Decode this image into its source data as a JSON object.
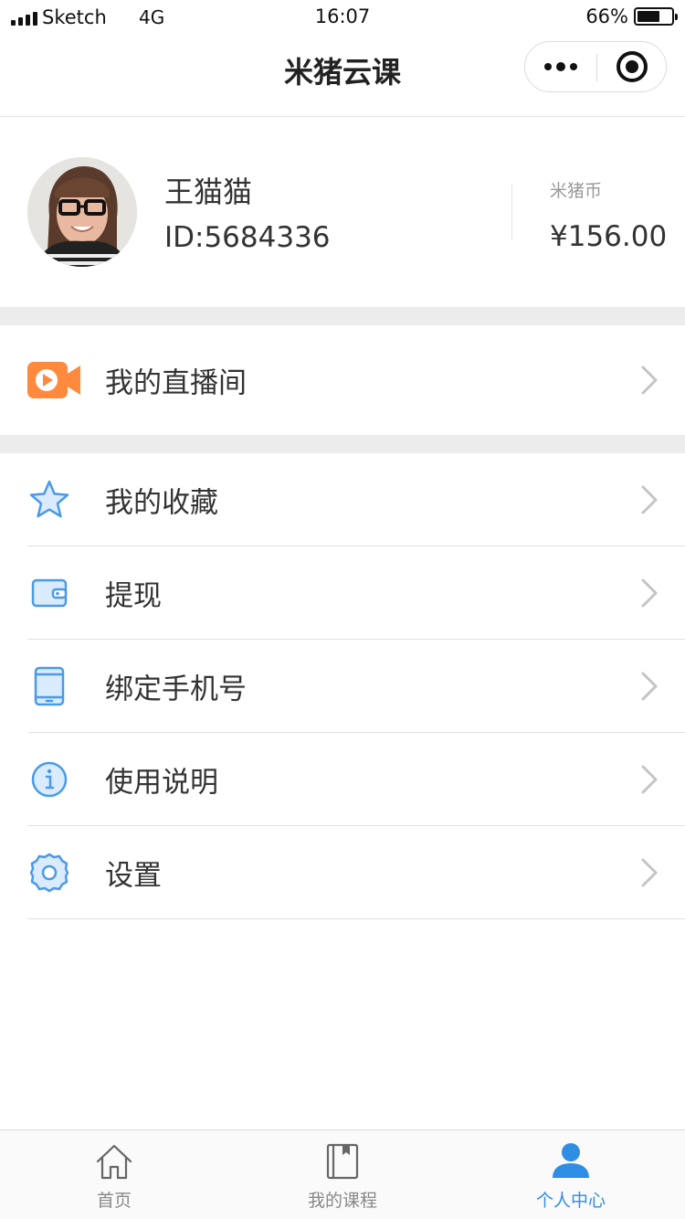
{
  "status_bar": {
    "carrier": "Sketch",
    "network": "4G",
    "time": "16:07",
    "battery_percent": "66%",
    "battery_level": 0.66
  },
  "nav": {
    "title": "米猪云课",
    "more_icon": "more-dots-icon",
    "close_icon": "target-close-icon"
  },
  "profile": {
    "name": "王猫猫",
    "id": "ID:5684336",
    "coin_label": "米猪币",
    "coin_value": "¥156.00"
  },
  "live_room": {
    "label": "我的直播间",
    "icon": "video-camera-icon"
  },
  "menu": {
    "items": [
      {
        "label": "我的收藏",
        "icon": "star-icon"
      },
      {
        "label": "提现",
        "icon": "wallet-icon"
      },
      {
        "label": "绑定手机号",
        "icon": "tablet-icon"
      },
      {
        "label": "使用说明",
        "icon": "info-icon"
      },
      {
        "label": "设置",
        "icon": "gear-icon"
      }
    ]
  },
  "tab_bar": {
    "tabs": [
      {
        "label": "首页",
        "icon": "home-icon"
      },
      {
        "label": "我的课程",
        "icon": "book-icon"
      },
      {
        "label": "个人中心",
        "icon": "person-icon",
        "active": true
      }
    ]
  },
  "colors": {
    "accent": "#2f8de4",
    "icon_blue": "#4a9ae8",
    "live_orange": "#ff8a3d",
    "separator": "#ececec"
  }
}
